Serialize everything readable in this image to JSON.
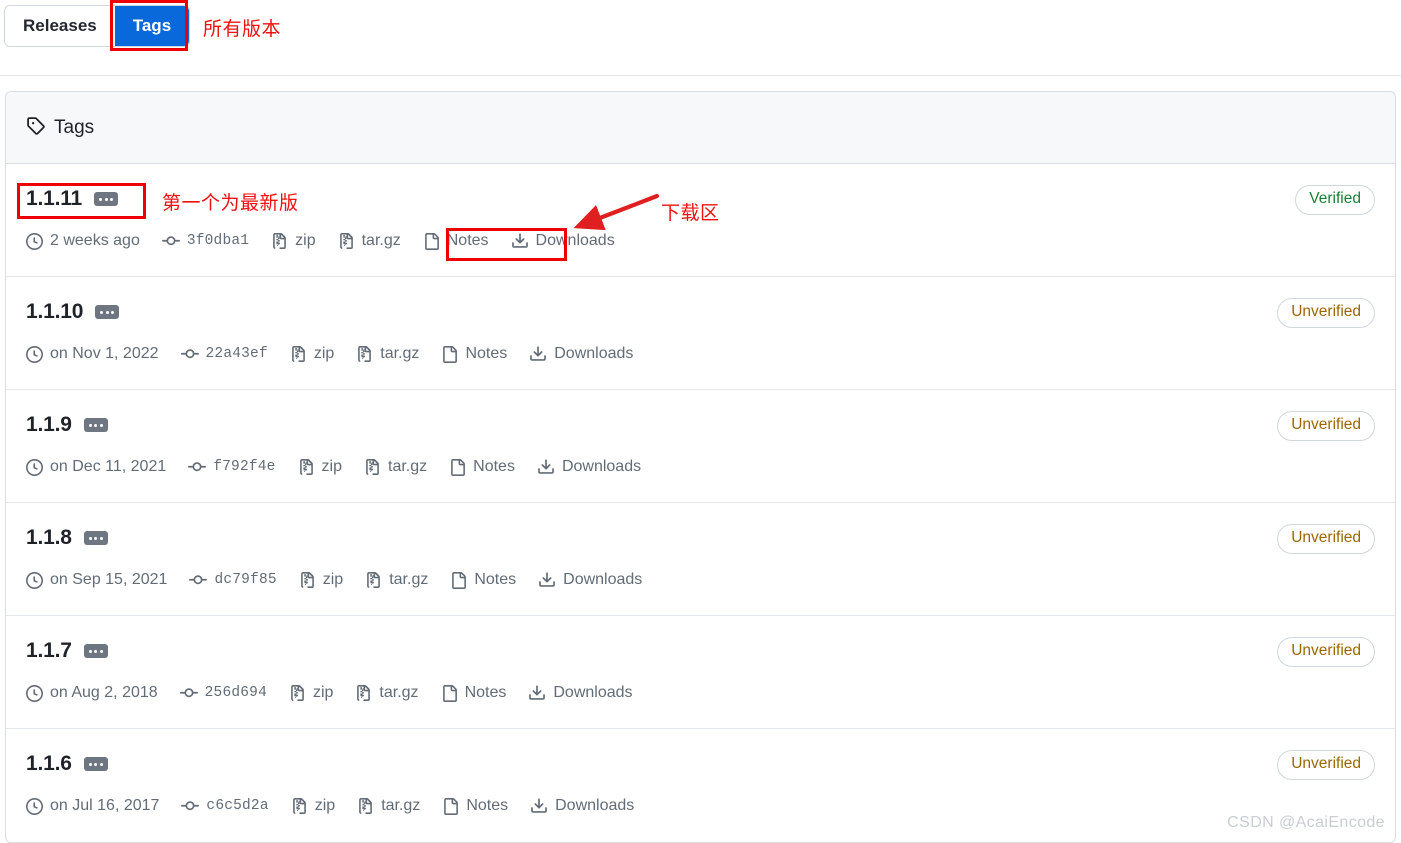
{
  "toggle": {
    "releases_label": "Releases",
    "tags_label": "Tags",
    "active": "Tags"
  },
  "annotations": {
    "all_versions": "所有版本",
    "first_is_latest": "第一个为最新版",
    "download_area": "下载区"
  },
  "card": {
    "header_title": "Tags",
    "header_icon": "tag-icon"
  },
  "labels": {
    "zip": "zip",
    "targz": "tar.gz",
    "notes": "Notes",
    "downloads": "Downloads",
    "verified": "Verified",
    "unverified": "Unverified"
  },
  "colors": {
    "accent_blue": "#0969da",
    "annotation_red": "#ee0000",
    "verified_green": "#1a7f37",
    "unverified_amber": "#9a6700",
    "border": "#d8dee4",
    "header_bg": "#f6f8fa",
    "muted_text": "#636c76"
  },
  "tags": [
    {
      "name": "1.1.11",
      "date": "2 weeks ago",
      "commit": "3f0dba1",
      "zip": "zip",
      "targz": "tar.gz",
      "notes": "Notes",
      "downloads": "Downloads",
      "status": "Verified",
      "status_kind": "verified"
    },
    {
      "name": "1.1.10",
      "date": "on Nov 1, 2022",
      "commit": "22a43ef",
      "zip": "zip",
      "targz": "tar.gz",
      "notes": "Notes",
      "downloads": "Downloads",
      "status": "Unverified",
      "status_kind": "unverified"
    },
    {
      "name": "1.1.9",
      "date": "on Dec 11, 2021",
      "commit": "f792f4e",
      "zip": "zip",
      "targz": "tar.gz",
      "notes": "Notes",
      "downloads": "Downloads",
      "status": "Unverified",
      "status_kind": "unverified"
    },
    {
      "name": "1.1.8",
      "date": "on Sep 15, 2021",
      "commit": "dc79f85",
      "zip": "zip",
      "targz": "tar.gz",
      "notes": "Notes",
      "downloads": "Downloads",
      "status": "Unverified",
      "status_kind": "unverified"
    },
    {
      "name": "1.1.7",
      "date": "on Aug 2, 2018",
      "commit": "256d694",
      "zip": "zip",
      "targz": "tar.gz",
      "notes": "Notes",
      "downloads": "Downloads",
      "status": "Unverified",
      "status_kind": "unverified"
    },
    {
      "name": "1.1.6",
      "date": "on Jul 16, 2017",
      "commit": "c6c5d2a",
      "zip": "zip",
      "targz": "tar.gz",
      "notes": "Notes",
      "downloads": "Downloads",
      "status": "Unverified",
      "status_kind": "unverified"
    }
  ],
  "watermark": "CSDN @AcaiEncode"
}
